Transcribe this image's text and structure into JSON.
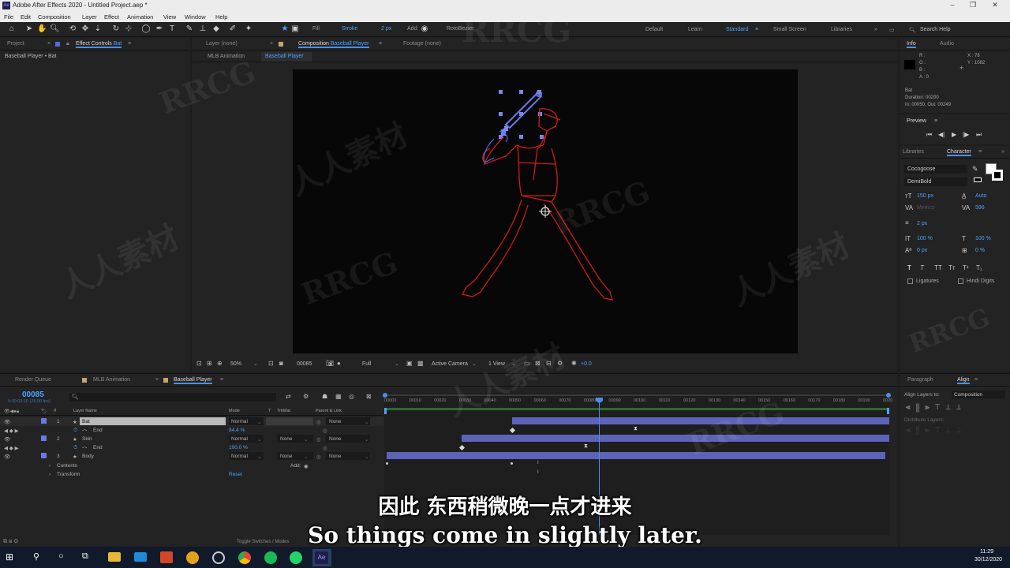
{
  "titlebar": {
    "app_title": "Adobe After Effects 2020 - Untitled Project.aep *",
    "app_badge": "Ae"
  },
  "menu": [
    "File",
    "Edit",
    "Composition",
    "Layer",
    "Effect",
    "Animation",
    "View",
    "Window",
    "Help"
  ],
  "toolbar": {
    "fill_label": "Fill",
    "stroke_label": "Stroke",
    "stroke_width": "2 px",
    "add_label": "Add:",
    "rotobezier_label": "RotoBezier",
    "workspaces": [
      "Default",
      "Learn",
      "Standard",
      "Small Screen",
      "Libraries"
    ],
    "active_workspace": "Standard",
    "search_placeholder": "Search Help"
  },
  "left_panel": {
    "project_tab": "Project",
    "effect_controls_tab": "Effect Controls",
    "effect_controls_target": "Bat",
    "breadcrumb": "Baseball Player • Bat"
  },
  "center_tabs": {
    "layer_tab": "Layer (none)",
    "composition_tab": "Composition",
    "composition_name": "Baseball Player",
    "footage_tab": "Footage (none)",
    "flow_items": [
      "MLB Animation",
      "Baseball Player"
    ]
  },
  "viewer_footer": {
    "zoom": "50%",
    "timecode": "00085",
    "resolution": "Full",
    "camera": "Active Camera",
    "views": "1 View",
    "exposure": "+0.0"
  },
  "info_panel": {
    "info_tab": "Info",
    "audio_tab": "Audio",
    "rgba": [
      "R :",
      "G :",
      "B :",
      "A : 0"
    ],
    "x": "X : 78",
    "y": "Y : 1082",
    "layer_name": "Bat",
    "duration": "Duration: 00200",
    "in_out": "In: 00050, Out: 00249"
  },
  "preview_panel": {
    "title": "Preview"
  },
  "character_panel": {
    "libraries_tab": "Libraries",
    "character_tab": "Character",
    "font": "Cocogoose",
    "style": "DemiBold",
    "font_size": "150 px",
    "leading": "Auto",
    "kerning": "Metrics",
    "tracking": "596",
    "stroke": "2 px",
    "vscale": "100 %",
    "hscale": "100 %",
    "baseline": "0 px",
    "tsume": "0 %",
    "ligatures": "Ligatures",
    "hindi_digits": "Hindi Digits",
    "style_buttons": [
      "T",
      "T",
      "TT",
      "Tт",
      "T¹",
      "T₁"
    ]
  },
  "timeline_tabs": [
    "Render Queue",
    "MLB Animation",
    "Baseball Player"
  ],
  "timeline": {
    "current_frame": "00085",
    "current_time": "0:00:03:10 (25.00 fps)",
    "columns": {
      "layer_name": "Layer Name",
      "mode": "Mode",
      "t": "T",
      "trkmat": "TrkMat",
      "parent": "Parent & Link"
    },
    "ruler": [
      "00000",
      "00010",
      "00020",
      "00030",
      "00040",
      "00050",
      "00060",
      "00070",
      "00080",
      "00090",
      "00100",
      "00110",
      "00120",
      "00130",
      "00140",
      "00150",
      "00160",
      "00170",
      "00180",
      "00190",
      "0020"
    ],
    "layers": [
      {
        "num": "1",
        "name": "Bat",
        "mode": "Normal",
        "trkmat": "",
        "parent": "None",
        "prop": "End",
        "value": "84.4 %"
      },
      {
        "num": "2",
        "name": "Skin",
        "mode": "Normal",
        "trkmat": "None",
        "parent": "None",
        "prop": "End",
        "value": "100.0 %"
      },
      {
        "num": "3",
        "name": "Body",
        "mode": "Normal",
        "trkmat": "None",
        "parent": "None"
      }
    ],
    "contents_label": "Contents",
    "add_label": "Add:",
    "transform_label": "Transform",
    "reset_label": "Reset",
    "footer_toggle": "Toggle Switches / Modes"
  },
  "right_bottom": {
    "paragraph_tab": "Paragraph",
    "align_tab": "Align",
    "align_layers_to": "Align Layers to:",
    "align_target": "Composition",
    "distribute": "Distribute Layers:"
  },
  "subtitles": {
    "zh": "因此 东西稍微晚一点才进来",
    "en": "So things come in slightly later."
  },
  "taskbar": {
    "time": "11:29",
    "date": "30/12/2020"
  },
  "watermarks": [
    "RRCG",
    "人人素材"
  ],
  "colors": {
    "accent": "#4aa3ff",
    "stroke_red": "#d11a1a",
    "selected_blue": "#6a79e6",
    "layer_bar": "#5c63b8"
  }
}
